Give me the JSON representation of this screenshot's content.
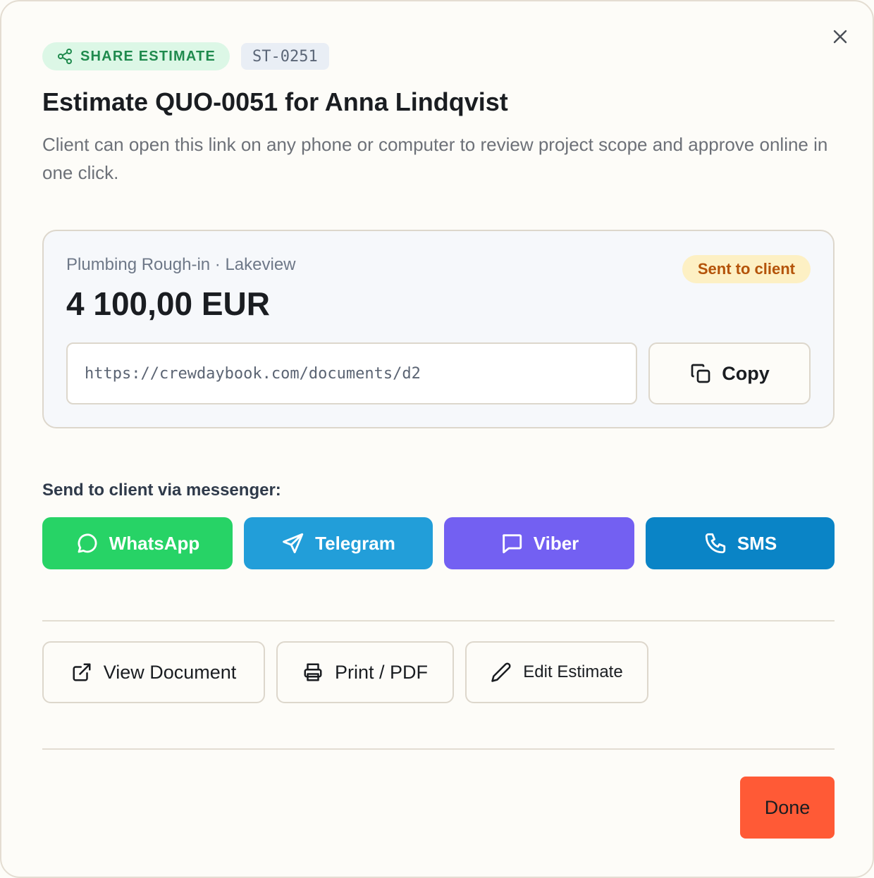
{
  "header": {
    "badge_label": "SHARE ESTIMATE",
    "doc_code": "ST-0251",
    "title": "Estimate QUO-0051 for Anna Lindqvist",
    "subtitle": "Client can open this link on any phone or computer to review project scope and approve online in one click."
  },
  "card": {
    "project": "Plumbing Rough-in · Lakeview",
    "amount": "4 100,00 EUR",
    "status": "Sent to client",
    "url": "https://crewdaybook.com/documents/d2",
    "copy_label": "Copy"
  },
  "messenger": {
    "label": "Send to client via messenger:",
    "buttons": [
      {
        "label": "WhatsApp",
        "icon": "whatsapp-icon",
        "color": "#27d366"
      },
      {
        "label": "Telegram",
        "icon": "telegram-icon",
        "color": "#229ed9"
      },
      {
        "label": "Viber",
        "icon": "viber-icon",
        "color": "#7360f2"
      },
      {
        "label": "SMS",
        "icon": "phone-icon",
        "color": "#0a84c6"
      }
    ]
  },
  "actions": {
    "view": "View Document",
    "print": "Print / PDF",
    "edit": "Edit Estimate"
  },
  "footer": {
    "done": "Done"
  },
  "colors": {
    "accent": "#ff5a36",
    "badge_green": "#1f8a4d",
    "status_amber": "#b45309"
  }
}
